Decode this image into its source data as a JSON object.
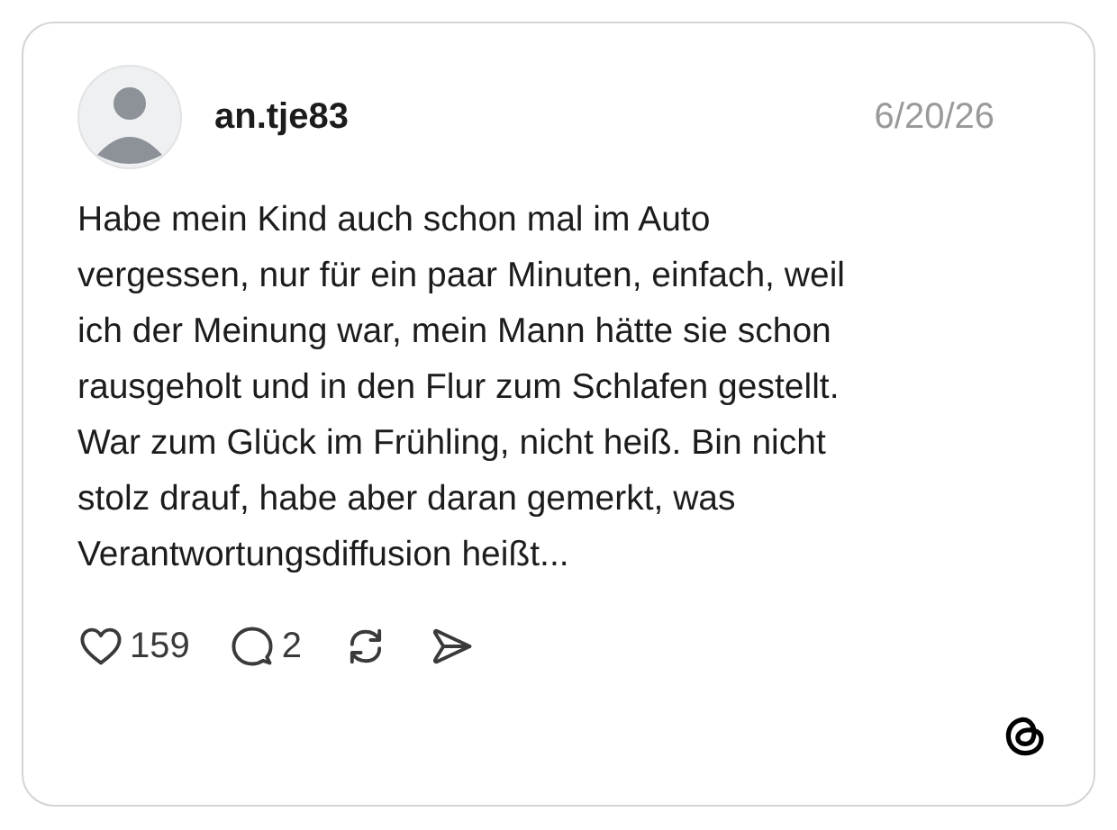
{
  "post": {
    "username": "an.tje83",
    "date": "6/20/26",
    "text": "Habe mein Kind auch schon mal im Auto\nvergessen, nur für ein paar Minuten, einfach, weil\nich der Meinung war, mein Mann hätte sie schon\nrausgeholt und in den Flur zum Schlafen gestellt.\nWar zum Glück im Frühling, nicht heiß. Bin nicht\nstolz drauf, habe aber daran gemerkt, was\nVerantwortungsdiffusion heißt...",
    "actions": [
      {
        "kind": "like",
        "count": "159"
      },
      {
        "kind": "reply",
        "count": "2"
      },
      {
        "kind": "repost"
      },
      {
        "kind": "share"
      }
    ]
  }
}
